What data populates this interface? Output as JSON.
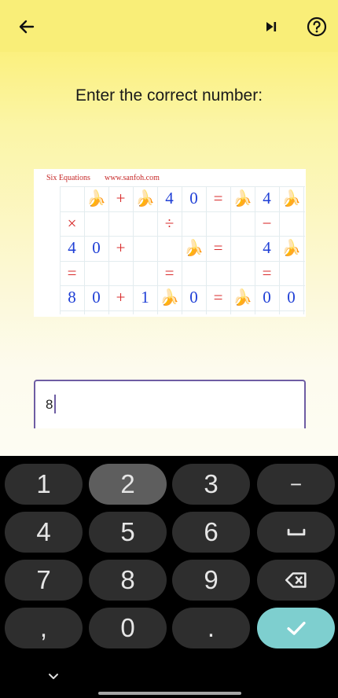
{
  "toolbar": {
    "back_icon": "arrow-left-icon",
    "skip_icon": "skip-next-icon",
    "help_icon": "help-circle-icon",
    "background": "#f9ee78"
  },
  "prompt": "Enter the correct number:",
  "puzzle": {
    "title": "Six Equations",
    "site": "www.sanfoh.com",
    "banana": "🍌",
    "cells": [
      {
        "r": 0,
        "c": 2,
        "v": "🍌"
      },
      {
        "r": 0,
        "c": 3,
        "v": "+",
        "k": "op"
      },
      {
        "r": 0,
        "c": 4,
        "v": "🍌"
      },
      {
        "r": 0,
        "c": 5,
        "v": "4",
        "k": "num"
      },
      {
        "r": 0,
        "c": 6,
        "v": "0",
        "k": "num"
      },
      {
        "r": 0,
        "c": 7,
        "v": "=",
        "k": "op"
      },
      {
        "r": 0,
        "c": 8,
        "v": "🍌"
      },
      {
        "r": 0,
        "c": 9,
        "v": "4",
        "k": "num"
      },
      {
        "r": 0,
        "c": 10,
        "v": "🍌"
      },
      {
        "r": 1,
        "c": 1,
        "v": "×",
        "k": "op"
      },
      {
        "r": 1,
        "c": 5,
        "v": "÷",
        "k": "op"
      },
      {
        "r": 1,
        "c": 9,
        "v": "−",
        "k": "op"
      },
      {
        "r": 2,
        "c": 1,
        "v": "4",
        "k": "num"
      },
      {
        "r": 2,
        "c": 2,
        "v": "0",
        "k": "num"
      },
      {
        "r": 2,
        "c": 3,
        "v": "+",
        "k": "op"
      },
      {
        "r": 2,
        "c": 6,
        "v": "🍌"
      },
      {
        "r": 2,
        "c": 7,
        "v": "=",
        "k": "op"
      },
      {
        "r": 2,
        "c": 9,
        "v": "4",
        "k": "num"
      },
      {
        "r": 2,
        "c": 10,
        "v": "🍌"
      },
      {
        "r": 3,
        "c": 1,
        "v": "=",
        "k": "op"
      },
      {
        "r": 3,
        "c": 5,
        "v": "=",
        "k": "op"
      },
      {
        "r": 3,
        "c": 9,
        "v": "=",
        "k": "op"
      },
      {
        "r": 4,
        "c": 1,
        "v": "8",
        "k": "num"
      },
      {
        "r": 4,
        "c": 2,
        "v": "0",
        "k": "num"
      },
      {
        "r": 4,
        "c": 3,
        "v": "+",
        "k": "op"
      },
      {
        "r": 4,
        "c": 4,
        "v": "1",
        "k": "num"
      },
      {
        "r": 4,
        "c": 5,
        "v": "🍌"
      },
      {
        "r": 4,
        "c": 6,
        "v": "0",
        "k": "num"
      },
      {
        "r": 4,
        "c": 7,
        "v": "=",
        "k": "op"
      },
      {
        "r": 4,
        "c": 8,
        "v": "🍌"
      },
      {
        "r": 4,
        "c": 9,
        "v": "0",
        "k": "num"
      },
      {
        "r": 4,
        "c": 10,
        "v": "0",
        "k": "num"
      }
    ],
    "colors": {
      "num": "#1f3fd6",
      "op": "#d82a2a",
      "title": "#c62828",
      "grid": "#e3ecef"
    }
  },
  "answer": {
    "value": "8"
  },
  "keyboard": {
    "rows": [
      [
        {
          "label": "1",
          "name": "key-1"
        },
        {
          "label": "2",
          "name": "key-2",
          "active": true
        },
        {
          "label": "3",
          "name": "key-3"
        },
        {
          "label": "−",
          "name": "key-minus"
        }
      ],
      [
        {
          "label": "4",
          "name": "key-4"
        },
        {
          "label": "5",
          "name": "key-5"
        },
        {
          "label": "6",
          "name": "key-6"
        },
        {
          "icon": "space",
          "name": "key-space"
        }
      ],
      [
        {
          "label": "7",
          "name": "key-7"
        },
        {
          "label": "8",
          "name": "key-8"
        },
        {
          "label": "9",
          "name": "key-9"
        },
        {
          "icon": "backspace",
          "name": "key-backspace"
        }
      ],
      [
        {
          "label": ",",
          "name": "key-comma"
        },
        {
          "label": "0",
          "name": "key-0"
        },
        {
          "label": ".",
          "name": "key-period"
        },
        {
          "icon": "check",
          "name": "key-enter",
          "enter": true
        }
      ]
    ],
    "colors": {
      "key": "#2e2e2e",
      "active": "#5e5e5e",
      "enter": "#7ecfcf",
      "text": "#e6e6e6"
    },
    "collapse_icon": "chevron-down-icon"
  }
}
